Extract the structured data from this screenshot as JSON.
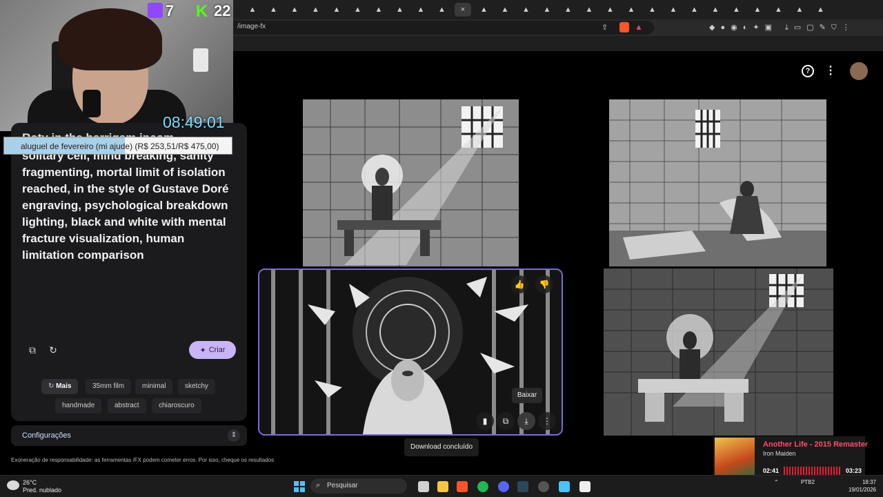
{
  "stream": {
    "twitch_count": "7",
    "kick_count": "22",
    "timer": "08:49:01",
    "donation_goal": {
      "text": "aluguel de fevereiro (mi ajude) (R$ 253,51/R$ 475,00)",
      "progress_fraction": 0.53
    }
  },
  "browser": {
    "url": "/image-fx",
    "tab_count": 28
  },
  "prompt": {
    "text_top_clipped": "Roty in the barrigam incom",
    "text": "solitary cell, mind breaking, sanity fragmenting, mortal limit of isolation reached, in the style of Gustave Doré engraving, psychological breakdown lighting, black and white with mental fracture visualization, human limitation comparison"
  },
  "actions": {
    "create_label": "Criar"
  },
  "chips": {
    "more": "Mais",
    "items": [
      "35mm film",
      "minimal",
      "sketchy",
      "handmade",
      "abstract",
      "chiaroscuro"
    ]
  },
  "settings": {
    "label": "Configurações"
  },
  "disclaimer": "Exoneração de responsabilidade: as ferramentas /FX podem cometer erros. Por isso, cheque os resultados",
  "image_overlay": {
    "tooltip": "Baixar",
    "toast": "Download concluído"
  },
  "music": {
    "title": "Another Life - 2015 Remaster",
    "artist": "Iron Maiden",
    "current": "02:41",
    "total": "03:23",
    "progress_fraction": 0.79
  },
  "taskbar": {
    "temp": "26°C",
    "weather": "Pred. nublado",
    "search": "Pesquisar",
    "lang": "PTB2",
    "time": "18:37",
    "date": "19/01/2026"
  },
  "colors": {
    "accent": "#c7b5f5",
    "selection": "#7a6fd6",
    "timer": "#7fdcff"
  }
}
